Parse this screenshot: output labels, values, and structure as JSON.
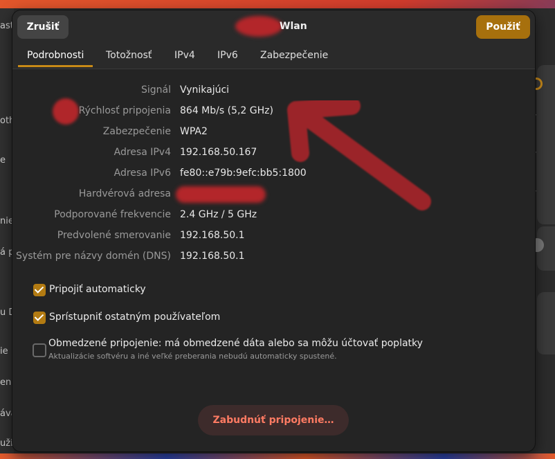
{
  "background": {
    "left_fragments": [
      "ast",
      "oth",
      "e",
      "nie",
      "á p",
      "u D",
      "ie",
      "eni",
      "áva",
      "uži"
    ]
  },
  "dialog": {
    "title": "Wlan",
    "cancel_label": "Zrušiť",
    "apply_label": "Použiť",
    "accent_color": "#a7700d"
  },
  "tabs": [
    {
      "label": "Podrobnosti",
      "active": true
    },
    {
      "label": "Totožnosť",
      "active": false
    },
    {
      "label": "IPv4",
      "active": false
    },
    {
      "label": "IPv6",
      "active": false
    },
    {
      "label": "Zabezpečenie",
      "active": false
    }
  ],
  "details": [
    {
      "label": "Signál",
      "value": "Vynikajúci"
    },
    {
      "label": "Rýchlosť pripojenia",
      "value": "864 Mb/s (5,2 GHz)"
    },
    {
      "label": "Zabezpečenie",
      "value": "WPA2"
    },
    {
      "label": "Adresa IPv4",
      "value": "192.168.50.167"
    },
    {
      "label": "Adresa IPv6",
      "value": "fe80::e79b:9efc:bb5:1800"
    },
    {
      "label": "Hardvérová adresa",
      "value": ""
    },
    {
      "label": "Podporované frekvencie",
      "value": "2.4 GHz / 5 GHz"
    },
    {
      "label": "Predvolené smerovanie",
      "value": "192.168.50.1"
    },
    {
      "label": "Systém pre názvy domén (DNS)",
      "value": "192.168.50.1"
    }
  ],
  "options": {
    "auto_connect": {
      "label": "Pripojiť automaticky",
      "checked": true
    },
    "share_users": {
      "label": "Sprístupniť ostatným používateľom",
      "checked": true
    },
    "metered": {
      "label": "Obmedzené pripojenie: má obmedzené dáta alebo sa môžu účtovať poplatky",
      "sublabel": "Aktualizácie softvéru a iné veľké preberania nebudú automaticky spustené.",
      "checked": false
    }
  },
  "forget_label": "Zabudnúť pripojenie…"
}
